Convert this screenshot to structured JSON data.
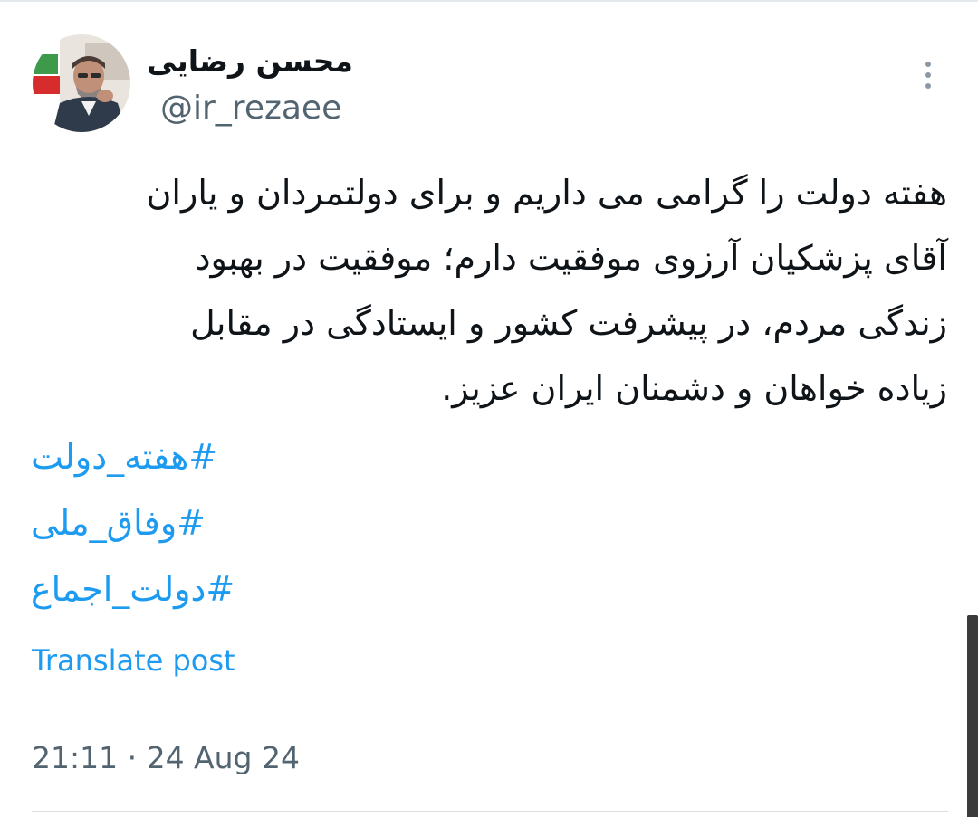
{
  "author": {
    "display_name": "محسن رضایی",
    "handle": "@ir_rezaee",
    "avatar_icon": "profile-photo"
  },
  "menu": {
    "icon": "more-vertical-icon"
  },
  "tweet": {
    "lines": [
      "هفته دولت را گرامی می داریم و برای دولتمردان و یاران",
      "آقای پزشکیان آرزوی موفقیت دارم؛ موفقیت در بهبود",
      "زندگی مردم، در پیشرفت کشور و ایستادگی در مقابل",
      "زیاده خواهان و دشمنان ایران عزیز."
    ],
    "hashtags": [
      "#هفته_دولت",
      "#وفاق_ملی",
      "#دولت_اجماع"
    ]
  },
  "translate_label": "Translate post",
  "timestamp": "21:11 · 24 Aug 24",
  "colors": {
    "link": "#1d9bf0",
    "secondary_text": "#536471",
    "primary_text": "#0f1419"
  }
}
